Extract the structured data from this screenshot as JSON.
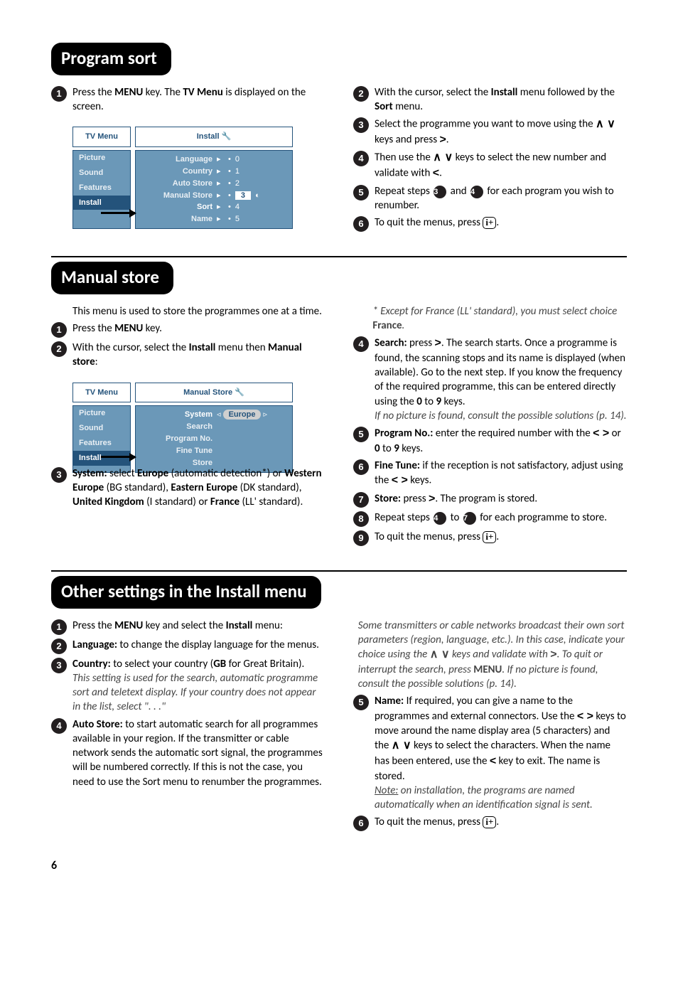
{
  "headers": {
    "sort": "Program sort",
    "manual": "Manual store",
    "other": "Other settings in the Install menu"
  },
  "sort": {
    "l1a": "Press the ",
    "l1menu": "MENU",
    "l1b": " key. The ",
    "l1tv": "TV Menu",
    "l1c": " is displayed on the screen.",
    "r2a": "With the cursor, select the ",
    "r2inst": "Install",
    "r2b": " menu followed by the ",
    "r2sort": "Sort",
    "r2c": " menu.",
    "r3a": "Select the programme you want to move using the ",
    "r3b": " keys and press ",
    "r3end": ".",
    "r4a": "Then use the ",
    "r4b": " keys to select the new number and validate with ",
    "r4end": ".",
    "r5a": "Repeat steps ",
    "r5b": " and ",
    "r5c": " for each program you wish to renumber.",
    "r6": "To quit the menus, press ",
    "r6end": ".",
    "tv": {
      "label": "TV Menu",
      "title": "Install",
      "side": [
        "Picture",
        "Sound",
        "Features",
        "Install"
      ],
      "activeSide": "Install",
      "rows": [
        {
          "k": "Language",
          "v": "0"
        },
        {
          "k": "Country",
          "v": "1"
        },
        {
          "k": "Auto Store",
          "v": "2"
        },
        {
          "k": "Manual Store",
          "v": "3",
          "hl": true
        },
        {
          "k": "Sort",
          "v": "4",
          "sort": true
        },
        {
          "k": "Name",
          "v": "5"
        }
      ]
    }
  },
  "manual": {
    "intro": "This menu is used to store the programmes one at a time.",
    "l1a": "Press the ",
    "l1menu": "MENU",
    "l1b": " key.",
    "l2a": "With the cursor, select the ",
    "l2inst": "Install",
    "l2b": " menu then ",
    "l2ms": "Manual store",
    "l2c": ":",
    "l3a": "System:",
    "l3b": " select ",
    "l3eu": "Europe",
    "l3c": " (automatic detection*) or ",
    "l3we": "Western Europe",
    "l3d": " (BG standard), ",
    "l3ee": "Eastern Europe",
    "l3e": " (DK standard), ",
    "l3uk": "United Kingdom",
    "l3f": " (I standard) or ",
    "l3fr": "France",
    "l3g": " (LL' standard).",
    "tv": {
      "label": "TV Menu",
      "title": "Manual Store",
      "side": [
        "Picture",
        "Sound",
        "Features",
        "Install"
      ],
      "activeSide": "Install",
      "rows": [
        {
          "k": "System",
          "euro": "Europe"
        },
        {
          "k": "Search",
          "v": ""
        },
        {
          "k": "Program No.",
          "v": ""
        },
        {
          "k": "Fine Tune",
          "v": ""
        },
        {
          "k": "Store",
          "v": ""
        }
      ]
    },
    "starA": "* ",
    "starB": "Except for France (LL' standard), you must select choice ",
    "starFr": "France",
    "starC": ".",
    "r4lbl": "Search:",
    "r4a": " press ",
    "r4b": ". The search starts. Once a programme is found, the scanning stops and its name is displayed (when available). Go to the next step. If you know the frequency of the required programme, this can be entered directly using the ",
    "r4zero": "0",
    "r4to": " to ",
    "r4nine": "9",
    "r4c": " keys.",
    "r4note": "If no picture is found, consult the possible solutions (p. 14).",
    "r5lbl": "Program No.:",
    "r5a": " enter the required number with the ",
    "r5b": " or ",
    "r5zero": "0",
    "r5to": " to ",
    "r5nine": "9",
    "r5c": " keys.",
    "r6lbl": "Fine Tune:",
    "r6a": " if the reception is not satisfactory, adjust using the ",
    "r6b": " keys.",
    "r7lbl": "Store:",
    "r7a": " press ",
    "r7b": ". The program is stored.",
    "r8a": "Repeat steps ",
    "r8b": " to ",
    "r8c": " for each programme to store.",
    "r9": "To quit the menus, press ",
    "r9end": "."
  },
  "other": {
    "l1a": "Press the ",
    "l1menu": "MENU",
    "l1b": " key and select the ",
    "l1inst": "Install",
    "l1c": " menu:",
    "l2lbl": "Language:",
    "l2a": " to change the display language for the menus.",
    "l3lbl": "Country:",
    "l3a": " to select your country (",
    "l3gb": "GB",
    "l3b": " for Great Britain).",
    "l3note": "This setting is used for the search, automatic programme sort and teletext display. If your country does not appear in the list, select \". . .\"",
    "l4lbl": "Auto Store:",
    "l4a": " to start automatic search for all programmes available in your region. If the transmitter or cable network sends the automatic sort signal, the programmes will be numbered correctly. If this is not the case, you need to use the Sort menu to renumber the programmes.",
    "r_noteA": "Some transmitters or cable networks broadcast their own sort parameters (region, language, etc.). In this case, indicate your choice using the ",
    "r_noteB": " keys and validate with ",
    "r_noteC": ". To quit or interrupt the search, press ",
    "r_noteMenu": "MENU",
    "r_noteD": ". If no picture is found, consult the possible solutions (p. 14).",
    "r5lbl": "Name:",
    "r5a": " If required, you can give a name to the programmes and external connectors. Use the ",
    "r5b": " keys to move around the name display area (5 characters) and the ",
    "r5c": " keys to select the characters. When the name has been entered, use the ",
    "r5d": " key to exit. The name is stored.",
    "r5noteU": "Note:",
    "r5note": " on installation, the programs are named automatically when an identification signal is sent.",
    "r6": "To quit the menus, press ",
    "r6end": "."
  },
  "page": "6"
}
